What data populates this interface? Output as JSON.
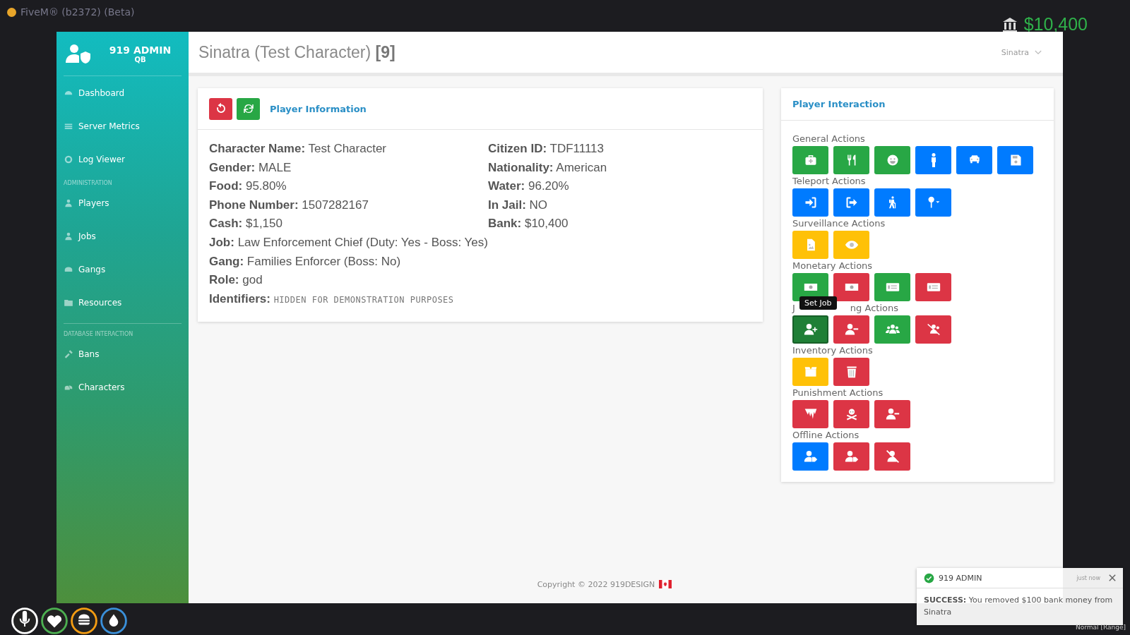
{
  "app_bar": {
    "title": "FiveM® (b2372) (Beta)"
  },
  "hud_money": {
    "amount": "$10,400"
  },
  "sidebar": {
    "brand": "919 ADMIN",
    "subtitle": "QB",
    "sections": [
      {
        "items": [
          {
            "label": "Dashboard"
          },
          {
            "label": "Server Metrics"
          },
          {
            "label": "Log Viewer"
          }
        ]
      },
      {
        "heading": "ADMINISTRATION",
        "items": [
          {
            "label": "Players"
          },
          {
            "label": "Jobs"
          },
          {
            "label": "Gangs"
          },
          {
            "label": "Resources"
          }
        ]
      },
      {
        "heading": "DATABASE INTERACTION",
        "items": [
          {
            "label": "Bans"
          },
          {
            "label": "Characters"
          }
        ]
      }
    ]
  },
  "header": {
    "title": "Sinatra (Test Character) **[9]**",
    "user_menu": "Sinatra"
  },
  "info_card": {
    "title": "Player Information",
    "buttons": [
      {
        "color": "#dc3545"
      },
      {
        "color": "#28a745"
      }
    ],
    "columns": [
      [
        {
          "label": "Character Name:",
          "value": "Test Character",
          "kind": "text"
        },
        {
          "label": "Gender:",
          "value": "MALE",
          "kind": "text"
        },
        {
          "label": "Food:",
          "value": "95.80%",
          "kind": "text"
        },
        {
          "label": "Phone Number:",
          "value": "1507282167",
          "kind": "text"
        },
        {
          "label": "Cash:",
          "value": "$1,150",
          "kind": "text"
        },
        {
          "label": "Job:",
          "value": "Law Enforcement Chief (Duty: Yes - Boss: Yes)",
          "kind": "text"
        },
        {
          "label": "Gang:",
          "value": "Families Enforcer (Boss: No)",
          "kind": "text"
        },
        {
          "label": "Role:",
          "value": "god",
          "kind": "text"
        },
        {
          "label": "Identifiers:",
          "value": "HIDDEN FOR DEMONSTRATION PURPOSES",
          "kind": "code"
        }
      ],
      [
        {
          "label": "Citizen ID:",
          "value": "TDF11113",
          "kind": "text"
        },
        {
          "label": "Nationality:",
          "value": "American",
          "kind": "text"
        },
        {
          "label": "Water:",
          "value": "96.20%",
          "kind": "text"
        },
        {
          "label": "In Jail:",
          "value": "NO",
          "kind": "text"
        },
        {
          "label": "Bank:",
          "value": "$10,400",
          "kind": "text"
        }
      ]
    ]
  },
  "interaction_card": {
    "title": "Player Interaction",
    "groups": [
      {
        "title_parts": [
          "General Actions"
        ],
        "buttons": [
          {
            "color": "#28a745",
            "hovered": false
          },
          {
            "color": "#28a745",
            "hovered": false
          },
          {
            "color": "#28a745",
            "hovered": false
          },
          {
            "color": "#007bff",
            "hovered": false
          },
          {
            "color": "#007bff",
            "hovered": false
          },
          {
            "color": "#007bff",
            "hovered": false
          }
        ]
      },
      {
        "title_parts": [
          "Teleport Actions"
        ],
        "buttons": [
          {
            "color": "#007bff",
            "hovered": false
          },
          {
            "color": "#007bff",
            "hovered": false
          },
          {
            "color": "#007bff",
            "hovered": false
          },
          {
            "color": "#007bff",
            "hovered": false
          }
        ]
      },
      {
        "title_parts": [
          "Surveillance Actions"
        ],
        "buttons": [
          {
            "color": "#ffc107",
            "hovered": false
          },
          {
            "color": "#ffc107",
            "hovered": false
          }
        ]
      },
      {
        "title_parts": [
          "Monetary Actions"
        ],
        "buttons": [
          {
            "color": "#28a745",
            "hovered": false
          },
          {
            "color": "#dc3545",
            "hovered": false
          },
          {
            "color": "#28a745",
            "hovered": false
          },
          {
            "color": "#dc3545",
            "hovered": false
          }
        ]
      },
      {
        "title_parts": [
          "J",
          "ng Actions"
        ],
        "buttons": [
          {
            "color": "#1f7f36",
            "hovered": true,
            "tooltip": "Set Job"
          },
          {
            "color": "#dc3545",
            "hovered": false
          },
          {
            "color": "#28a745",
            "hovered": false
          },
          {
            "color": "#dc3545",
            "hovered": false
          }
        ]
      },
      {
        "title_parts": [
          "Inventory Actions"
        ],
        "buttons": [
          {
            "color": "#ffc107",
            "hovered": false
          },
          {
            "color": "#dc3545",
            "hovered": false
          }
        ]
      },
      {
        "title_parts": [
          "Punishment Actions"
        ],
        "buttons": [
          {
            "color": "#dc3545",
            "hovered": false
          },
          {
            "color": "#dc3545",
            "hovered": false
          },
          {
            "color": "#dc3545",
            "hovered": false
          }
        ]
      },
      {
        "title_parts": [
          "Offline Actions"
        ],
        "buttons": [
          {
            "color": "#007bff",
            "hovered": false
          },
          {
            "color": "#dc3545",
            "hovered": false
          },
          {
            "color": "#dc3545",
            "hovered": false
          }
        ]
      }
    ]
  },
  "footer": {
    "text": "Copyright © 2022 919DESIGN"
  },
  "hud": [
    {
      "color": "#ffffff"
    },
    {
      "color": "#4caf50"
    },
    {
      "color": "#f39c12"
    },
    {
      "color": "#3a8fd8"
    }
  ],
  "notification": {
    "title": "919 ADMIN",
    "time": "just now",
    "message": "**SUCCESS:** You removed $100 bank money from Sinatra"
  },
  "voice_mode": "Normal [Range]"
}
